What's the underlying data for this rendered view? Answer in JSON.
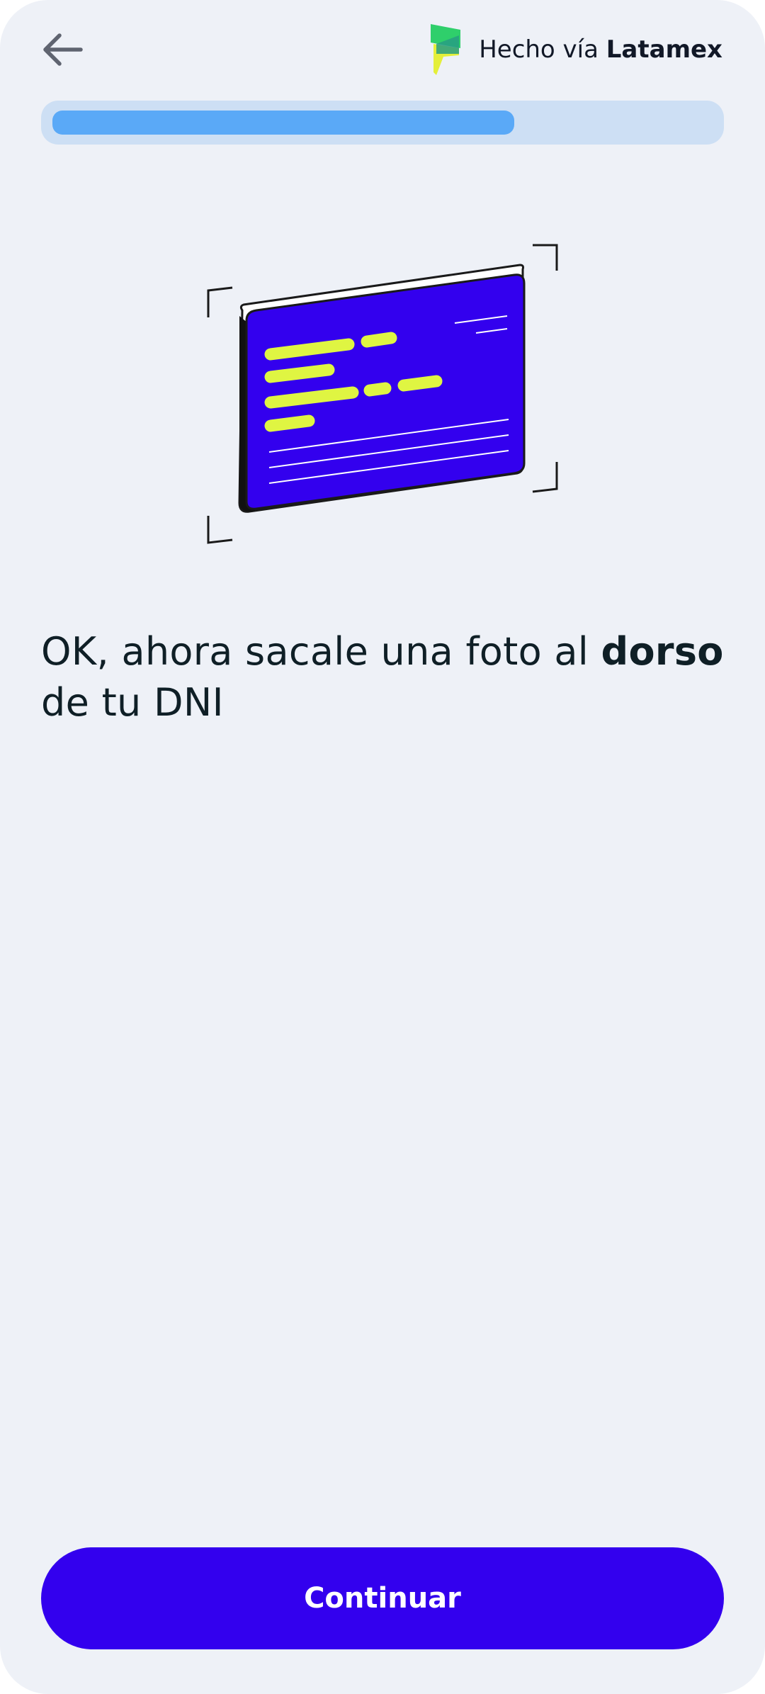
{
  "header": {
    "back_icon": "arrow-left-icon",
    "brand_prefix": "Hecho vía",
    "brand_name": "Latamex",
    "brand_logo": "latamex-flag-logo"
  },
  "progress": {
    "fraction": 0.7
  },
  "illustration": {
    "icon": "id-card-back-scan-icon"
  },
  "instruction": {
    "text_before": "OK, ahora sacale una foto al",
    "text_bold": "dorso",
    "text_after": "de tu DNI"
  },
  "footer": {
    "continue_label": "Continuar"
  },
  "colors": {
    "background": "#eef1f7",
    "primary": "#3300ee",
    "progress_track": "#cddff4",
    "progress_fill": "#5aa9f7",
    "card_highlight": "#dff542"
  }
}
